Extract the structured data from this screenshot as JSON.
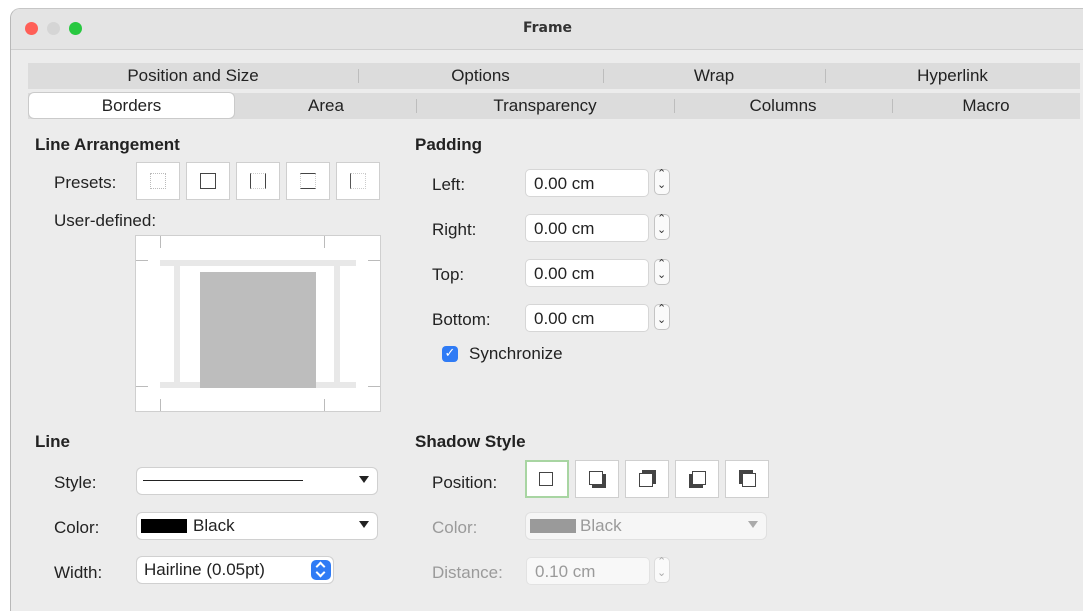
{
  "window": {
    "title": "Frame"
  },
  "colors": {
    "close": "#ff5f57",
    "minimize": "#d5d5d5",
    "zoom": "#28c840",
    "accent": "#2f7bf5",
    "shadow_selected": "#a8d5a2"
  },
  "tabs_row1": [
    "Position and Size",
    "Options",
    "Wrap",
    "Hyperlink"
  ],
  "tabs_row2": [
    "Borders",
    "Area",
    "Transparency",
    "Columns",
    "Macro"
  ],
  "active_tab": "Borders",
  "line_arrangement": {
    "heading": "Line Arrangement",
    "presets_label": "Presets:",
    "presets": [
      "no-borders-icon",
      "outer-border-icon",
      "left-right-border-icon",
      "top-bottom-border-icon",
      "left-border-icon"
    ],
    "user_defined_label": "User-defined:"
  },
  "padding": {
    "heading": "Padding",
    "left_label": "Left:",
    "left_value": "0.00 cm",
    "right_label": "Right:",
    "right_value": "0.00 cm",
    "top_label": "Top:",
    "top_value": "0.00 cm",
    "bottom_label": "Bottom:",
    "bottom_value": "0.00 cm",
    "synchronize_label": "Synchronize",
    "synchronize_checked": true
  },
  "line": {
    "heading": "Line",
    "style_label": "Style:",
    "color_label": "Color:",
    "color_value": "Black",
    "width_label": "Width:",
    "width_value": "Hairline (0.05pt)"
  },
  "shadow": {
    "heading": "Shadow Style",
    "position_label": "Position:",
    "positions": [
      "no-shadow-icon",
      "shadow-bottom-right-icon",
      "shadow-top-right-icon",
      "shadow-bottom-left-icon",
      "shadow-top-left-icon"
    ],
    "color_label": "Color:",
    "color_value": "Black",
    "distance_label": "Distance:",
    "distance_value": "0.10 cm"
  }
}
